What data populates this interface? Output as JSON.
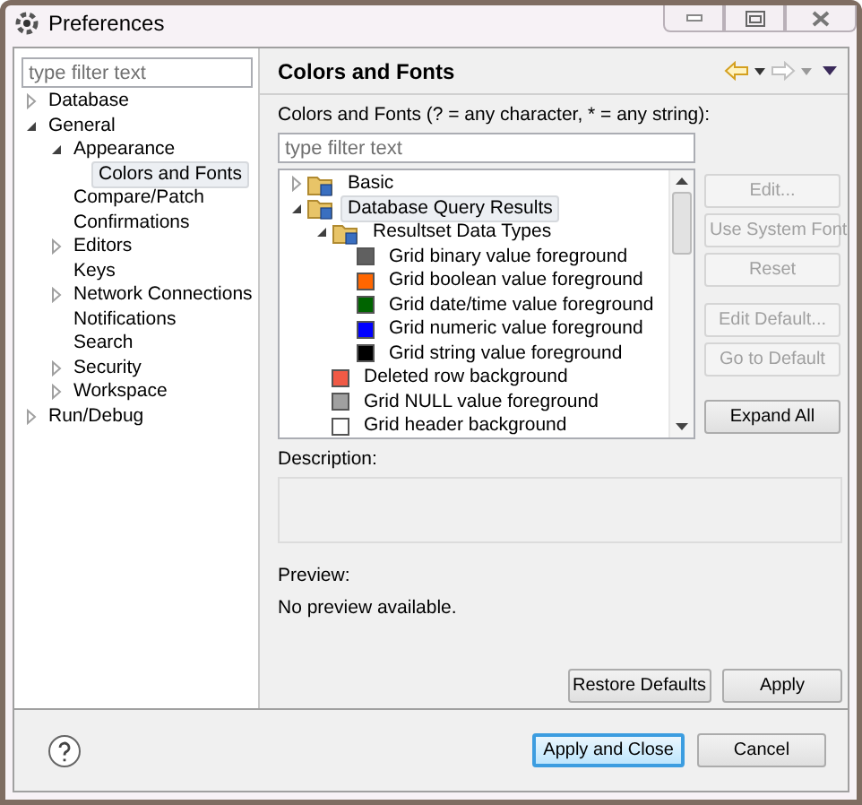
{
  "window": {
    "title": "Preferences"
  },
  "nav": {
    "filter": {
      "placeholder": "type filter text"
    },
    "items": [
      {
        "label": "Database",
        "kind": "branch",
        "expanded": false,
        "selected": false
      },
      {
        "label": "General",
        "kind": "branch",
        "expanded": true,
        "selected": false,
        "children": [
          {
            "label": "Appearance",
            "kind": "branch",
            "expanded": true,
            "selected": false,
            "children": [
              {
                "label": "Colors and Fonts",
                "kind": "leaf",
                "selected": true
              }
            ]
          },
          {
            "label": "Compare/Patch",
            "kind": "leaf",
            "selected": false
          },
          {
            "label": "Confirmations",
            "kind": "leaf",
            "selected": false
          },
          {
            "label": "Editors",
            "kind": "branch",
            "expanded": false,
            "selected": false
          },
          {
            "label": "Keys",
            "kind": "leaf",
            "selected": false
          },
          {
            "label": "Network Connections",
            "kind": "branch",
            "expanded": false,
            "selected": false
          },
          {
            "label": "Notifications",
            "kind": "leaf",
            "selected": false
          },
          {
            "label": "Search",
            "kind": "leaf",
            "selected": false
          },
          {
            "label": "Security",
            "kind": "branch",
            "expanded": false,
            "selected": false
          },
          {
            "label": "Workspace",
            "kind": "branch",
            "expanded": false,
            "selected": false
          }
        ]
      },
      {
        "label": "Run/Debug",
        "kind": "branch",
        "expanded": false,
        "selected": false
      }
    ]
  },
  "page": {
    "title": "Colors and Fonts",
    "instructions": "Colors and Fonts (? = any character, * = any string):",
    "filter": {
      "placeholder": "type filter text"
    },
    "tree": [
      {
        "label": "Basic",
        "kind": "folder",
        "expanded": false,
        "selected": false
      },
      {
        "label": "Database Query Results",
        "kind": "folder",
        "expanded": true,
        "selected": true,
        "children": [
          {
            "label": "Resultset Data Types",
            "kind": "folder",
            "expanded": true,
            "selected": false,
            "children": [
              {
                "label": "Grid binary value foreground",
                "kind": "color",
                "color": "#606060",
                "selected": false
              },
              {
                "label": "Grid boolean value foreground",
                "kind": "color",
                "color": "#ff6600",
                "selected": false
              },
              {
                "label": "Grid date/time value foreground",
                "kind": "color",
                "color": "#006400",
                "selected": false
              },
              {
                "label": "Grid numeric value foreground",
                "kind": "color",
                "color": "#0000ff",
                "selected": false
              },
              {
                "label": "Grid string value foreground",
                "kind": "color",
                "color": "#000000",
                "selected": false
              }
            ]
          },
          {
            "label": "Deleted row background",
            "kind": "color",
            "color": "#f05a46",
            "selected": false
          },
          {
            "label": "Grid NULL value foreground",
            "kind": "color",
            "color": "#a0a0a0",
            "selected": false
          },
          {
            "label": "Grid header background",
            "kind": "color",
            "color": "#ffffff",
            "selected": false
          }
        ]
      }
    ],
    "side_button_groups": [
      [
        {
          "label": "Edit...",
          "disabled": true
        },
        {
          "label": "Use System Font",
          "disabled": true
        },
        {
          "label": "Reset",
          "disabled": true
        }
      ],
      [
        {
          "label": "Edit Default...",
          "disabled": true
        },
        {
          "label": "Go to Default",
          "disabled": true
        }
      ],
      [
        {
          "label": "Expand All",
          "disabled": false
        }
      ]
    ],
    "description_label": "Description:",
    "preview_label": "Preview:",
    "preview_text": "No preview available.",
    "page_buttons": [
      "Restore Defaults",
      "Apply"
    ]
  },
  "footer": {
    "buttons": [
      {
        "label": "Apply and Close",
        "default": true
      },
      {
        "label": "Cancel",
        "default": false
      }
    ]
  }
}
